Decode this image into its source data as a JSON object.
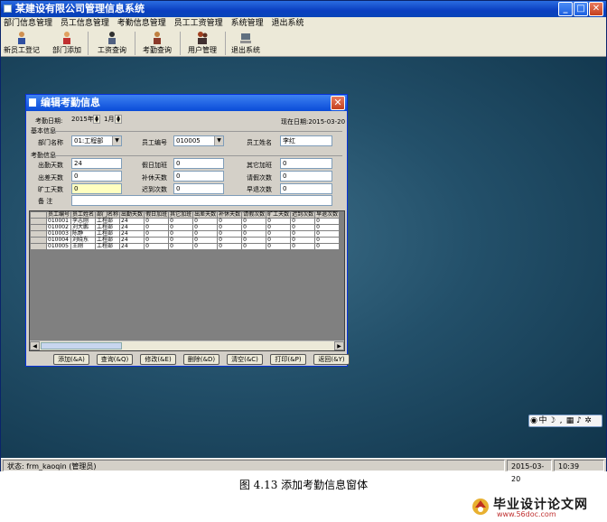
{
  "app": {
    "title": "某建设有限公司管理信息系统",
    "window_buttons": [
      "_",
      "□",
      "✕"
    ]
  },
  "menu": [
    "部门信息管理",
    "员工信息管理",
    "考勤信息管理",
    "员工工资管理",
    "系统管理",
    "退出系统"
  ],
  "toolbar": [
    {
      "label": "新员工登记",
      "icon": "user-add-icon"
    },
    {
      "label": "部门添加",
      "icon": "department-icon"
    },
    {
      "label": "工资查询",
      "icon": "salary-icon"
    },
    {
      "label": "考勤查询",
      "icon": "attendance-icon"
    },
    {
      "label": "用户管理",
      "icon": "users-icon"
    },
    {
      "label": "退出系统",
      "icon": "exit-icon"
    }
  ],
  "dialog": {
    "title": "编辑考勤信息",
    "date_label": "考勤日期:",
    "year_value": "2015年",
    "month_value": "1月",
    "current_date": "现在日期:2015-03-20",
    "basic_section": "基本信息",
    "dept_label": "部门名称",
    "dept_value": "01:工程部",
    "emp_no_label": "员工编号",
    "emp_no_value": "010005",
    "emp_name_label": "员工姓名",
    "emp_name_value": "李红",
    "attendance_section": "考勤信息",
    "fields": {
      "work_days_label": "出勤天数",
      "work_days_value": "24",
      "holiday_ot_label": "假日加班",
      "holiday_ot_value": "0",
      "other_ot_label": "其它加班",
      "other_ot_value": "0",
      "trip_days_label": "出差天数",
      "trip_days_value": "0",
      "makeup_days_label": "补休天数",
      "makeup_days_value": "0",
      "leave_label": "请假次数",
      "leave_value": "0",
      "absent_label": "旷工天数",
      "absent_value": "0",
      "late_label": "迟到次数",
      "late_value": "0",
      "early_label": "早退次数",
      "early_value": "0",
      "remark_label": "备 注",
      "remark_value": ""
    },
    "grid_headers": [
      "员工编号",
      "员工姓名",
      "部门名称",
      "出勤天数",
      "假日加班",
      "其它加班",
      "出差天数",
      "补休天数",
      "请假次数",
      "旷工天数",
      "迟到次数",
      "早退次数"
    ],
    "grid_rows": [
      [
        "010001",
        "李志刚",
        "工程部",
        "24",
        "0",
        "0",
        "0",
        "0",
        "0",
        "0",
        "0",
        "0"
      ],
      [
        "010002",
        "刘大鹏",
        "工程部",
        "24",
        "0",
        "0",
        "0",
        "0",
        "0",
        "0",
        "0",
        "0"
      ],
      [
        "010003",
        "陈静",
        "工程部",
        "24",
        "0",
        "0",
        "0",
        "0",
        "0",
        "0",
        "0",
        "0"
      ],
      [
        "010004",
        "刘晓东",
        "工程部",
        "24",
        "0",
        "0",
        "0",
        "0",
        "0",
        "0",
        "0",
        "0"
      ],
      [
        "010005",
        "王刚",
        "工程部",
        "24",
        "0",
        "0",
        "0",
        "0",
        "0",
        "0",
        "0",
        "0"
      ]
    ],
    "buttons": [
      "添加(&A)",
      "查询(&Q)",
      "修改(&E)",
      "删除(&D)",
      "清空(&C)",
      "打印(&P)",
      "返回(&Y)"
    ]
  },
  "status": {
    "user": "状态: frm_kaoqin (管理员)",
    "date": "2015-03-20",
    "time": "10:39"
  },
  "ime": {
    "label": "中"
  },
  "caption": "图 4.13  添加考勤信息窗体",
  "watermark": {
    "main": "毕业设计论文网",
    "url": "www.56doc.com"
  }
}
